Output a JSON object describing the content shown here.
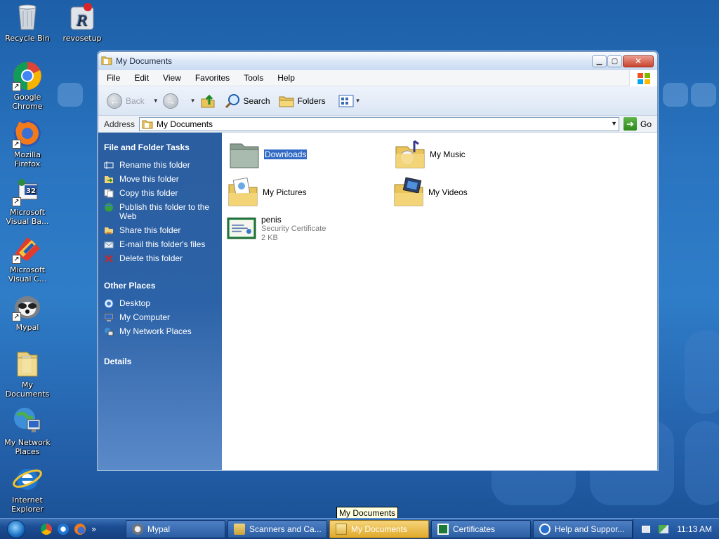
{
  "desktop": {
    "icons": [
      {
        "label": "Recycle Bin",
        "icon": "recycle-bin-icon"
      },
      {
        "label": "revosetup",
        "icon": "revo-uninstaller-icon"
      },
      {
        "label": "Google Chrome",
        "icon": "chrome-icon"
      },
      {
        "label": "Mozilla Firefox",
        "icon": "firefox-icon"
      },
      {
        "label": "Microsoft Visual Ba...",
        "icon": "visual-basic-icon"
      },
      {
        "label": "Microsoft Visual C...",
        "icon": "visual-cpp-icon"
      },
      {
        "label": "Mypal",
        "icon": "mypal-icon"
      },
      {
        "label": "My Documents",
        "icon": "folder-icon"
      },
      {
        "label": "My Network Places",
        "icon": "network-places-icon"
      },
      {
        "label": "Internet Explorer",
        "icon": "internet-explorer-icon"
      }
    ]
  },
  "window": {
    "title": "My Documents",
    "menu": [
      "File",
      "Edit",
      "View",
      "Favorites",
      "Tools",
      "Help"
    ],
    "toolbar": {
      "back": "Back",
      "search": "Search",
      "folders": "Folders"
    },
    "address": {
      "label": "Address",
      "value": "My Documents",
      "go": "Go"
    },
    "tasks": {
      "heading": "File and Folder Tasks",
      "items": [
        "Rename this folder",
        "Move this folder",
        "Copy this folder",
        "Publish this folder to the Web",
        "Share this folder",
        "E-mail this folder's files",
        "Delete this folder"
      ]
    },
    "other_places": {
      "heading": "Other Places",
      "items": [
        "Desktop",
        "My Computer",
        "My Network Places"
      ]
    },
    "details": {
      "heading": "Details"
    },
    "files": [
      {
        "name": "Downloads",
        "selected": true
      },
      {
        "name": "My Music"
      },
      {
        "name": "My Pictures"
      },
      {
        "name": "My Videos"
      },
      {
        "name": "penis",
        "type": "Security Certificate",
        "size": "2 KB"
      }
    ]
  },
  "taskbar": {
    "tasks": [
      {
        "label": "Mypal",
        "active": false
      },
      {
        "label": "Scanners and Ca...",
        "active": false
      },
      {
        "label": "My Documents",
        "active": true
      },
      {
        "label": "Certificates",
        "active": false
      },
      {
        "label": "Help and Suppor...",
        "active": false
      }
    ],
    "clock": "11:13 AM",
    "tooltip": "My Documents",
    "quicklaunch_chevron": "»"
  }
}
